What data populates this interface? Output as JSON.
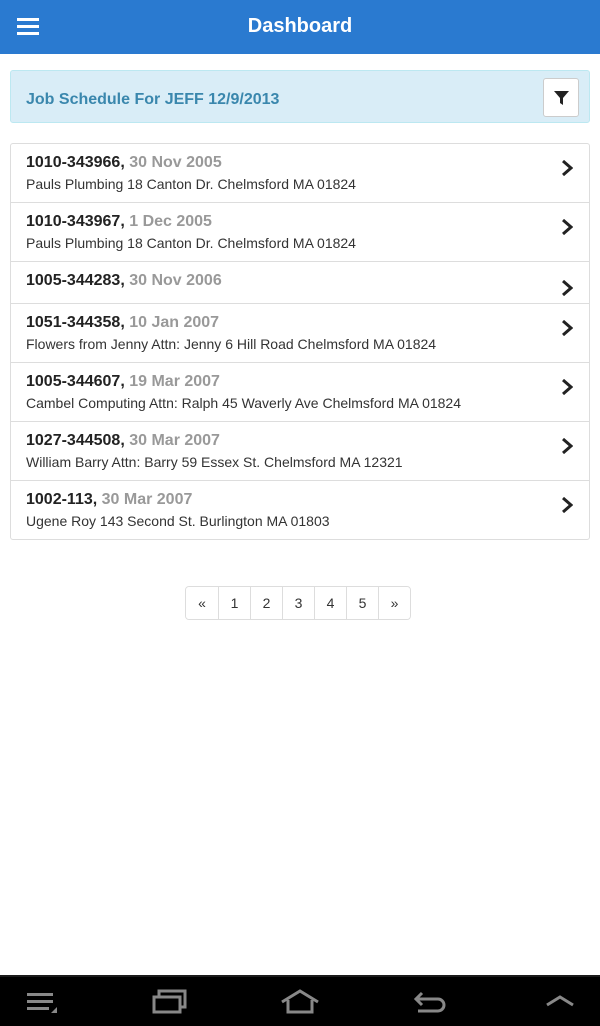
{
  "header": {
    "title": "Dashboard",
    "menu_icon": "hamburger-menu-icon"
  },
  "schedule": {
    "title": "Job Schedule For JEFF 12/9/2013",
    "filter_icon": "filter-icon"
  },
  "jobs": [
    {
      "id": "1010-343966,",
      "date": "30 Nov 2005",
      "address": "Pauls Plumbing 18 Canton Dr. Chelmsford MA 01824"
    },
    {
      "id": "1010-343967,",
      "date": "1 Dec 2005",
      "address": "Pauls Plumbing 18 Canton Dr. Chelmsford MA 01824"
    },
    {
      "id": "1005-344283,",
      "date": "30 Nov 2006",
      "address": ""
    },
    {
      "id": "1051-344358,",
      "date": "10 Jan 2007",
      "address": "Flowers from Jenny Attn: Jenny 6 Hill Road Chelmsford MA 01824"
    },
    {
      "id": "1005-344607,",
      "date": "19 Mar 2007",
      "address": "Cambel Computing Attn: Ralph 45 Waverly Ave Chelmsford MA 01824"
    },
    {
      "id": "1027-344508,",
      "date": "30 Mar 2007",
      "address": "William Barry Attn: Barry 59 Essex St. Chelmsford MA 12321"
    },
    {
      "id": "1002-113,",
      "date": "30 Mar 2007",
      "address": "Ugene Roy 143 Second St. Burlington MA 01803"
    }
  ],
  "pagination": [
    "«",
    "1",
    "2",
    "3",
    "4",
    "5",
    "»"
  ],
  "system_nav": [
    "menu-icon",
    "recent-apps-icon",
    "home-icon",
    "back-icon",
    "up-arrow-icon"
  ],
  "colors": {
    "header": "#2a7ad0",
    "panel_bg": "#d9edf7",
    "panel_text": "#3a87ad",
    "date_text": "#999999"
  }
}
